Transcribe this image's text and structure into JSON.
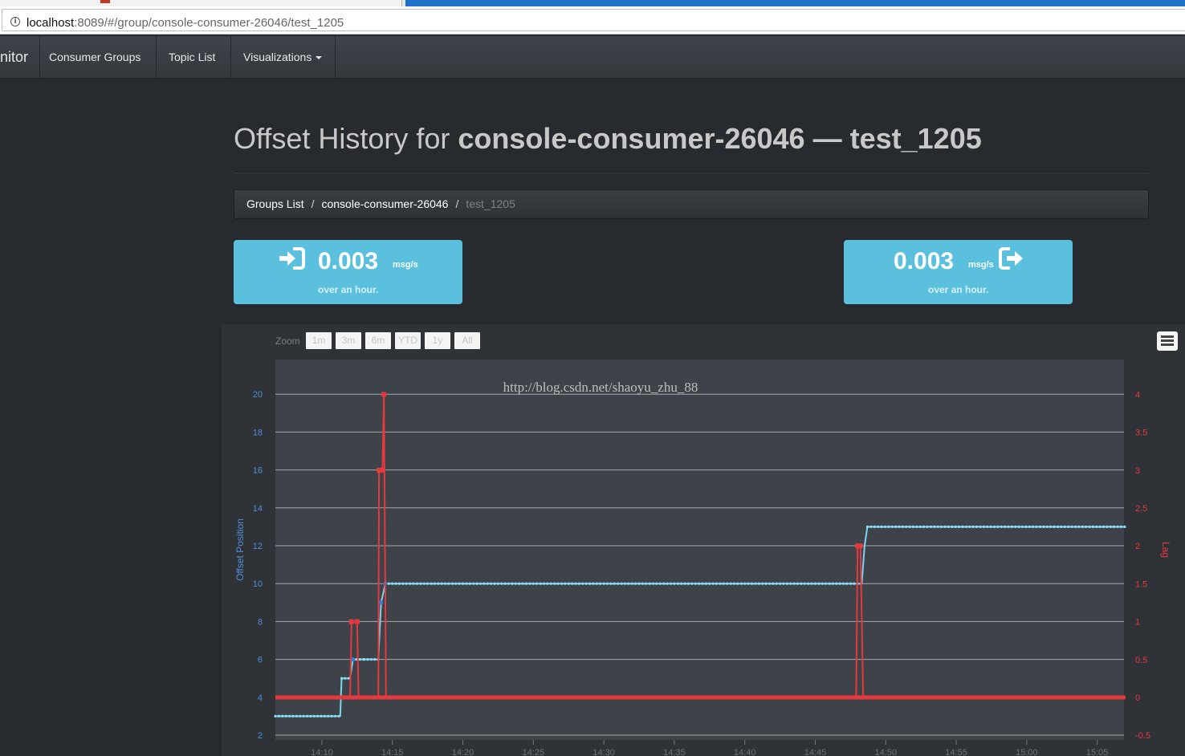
{
  "browser": {
    "url_host": "localhost",
    "url_rest": ":8089/#/group/console-consumer-26046/test_1205"
  },
  "navbar": {
    "brand": "nitor",
    "items": [
      "Consumer Groups",
      "Topic List",
      "Visualizations"
    ]
  },
  "page": {
    "title_prefix": "Offset History for ",
    "group": "console-consumer-26046",
    "dash": " — ",
    "topic": "test_1205"
  },
  "breadcrumb": {
    "items": [
      "Groups List",
      "console-consumer-26046"
    ],
    "active": "test_1205",
    "sep": "/"
  },
  "stats": {
    "in": {
      "value": "0.003",
      "unit": "msg/s",
      "sub": "over an hour."
    },
    "out": {
      "value": "0.003",
      "unit": "msg/s",
      "sub": "over an hour."
    }
  },
  "chart_controls": {
    "zoom_label": "Zoom",
    "zoom_buttons": [
      "1m",
      "3m",
      "6m",
      "YTD",
      "1y",
      "All"
    ]
  },
  "chart_data": {
    "type": "line",
    "watermark": "http://blog.csdn.net/shaoyu_zhu_88",
    "x_ticks": [
      "14:10",
      "14:15",
      "14:20",
      "14:25",
      "14:30",
      "14:35",
      "14:40",
      "14:45",
      "14:50",
      "14:55",
      "15:00",
      "15:05"
    ],
    "xlim_minutes": [
      6.7,
      66.9
    ],
    "left_axis": {
      "label": "Offset Position",
      "ticks": [
        "2",
        "4",
        "6",
        "8",
        "10",
        "12",
        "14",
        "16",
        "18",
        "20"
      ],
      "ylim": [
        2,
        22
      ]
    },
    "right_axis": {
      "label": "Lag",
      "ticks": [
        "-0.5",
        "0",
        "0.5",
        "1",
        "1.5",
        "2",
        "2.5",
        "3",
        "3.5",
        "4"
      ],
      "ylim": [
        -0.5,
        4.5
      ]
    },
    "x_unit_note": "minutes after 14:00",
    "series": [
      {
        "axis": "left",
        "color": "#7ad6ee",
        "points": [
          [
            6.7,
            3
          ],
          [
            11.3,
            3
          ],
          [
            11.4,
            5
          ],
          [
            12.0,
            5
          ],
          [
            12.2,
            6
          ],
          [
            13.0,
            6
          ],
          [
            14.0,
            6
          ],
          [
            14.2,
            9
          ],
          [
            14.5,
            10
          ],
          [
            48.3,
            10
          ],
          [
            48.5,
            12
          ],
          [
            48.7,
            13
          ],
          [
            67.0,
            13
          ]
        ]
      },
      {
        "axis": "right",
        "color": "#e5393d",
        "points": [
          [
            6.7,
            0
          ],
          [
            12.0,
            0
          ],
          [
            12.1,
            1
          ],
          [
            12.5,
            1
          ],
          [
            12.6,
            0
          ],
          [
            14.0,
            0
          ],
          [
            14.05,
            3
          ],
          [
            14.3,
            3
          ],
          [
            14.4,
            4
          ],
          [
            14.55,
            0
          ],
          [
            47.9,
            0
          ],
          [
            48.0,
            2
          ],
          [
            48.2,
            2
          ],
          [
            48.4,
            0
          ],
          [
            67.0,
            0
          ]
        ]
      }
    ]
  }
}
